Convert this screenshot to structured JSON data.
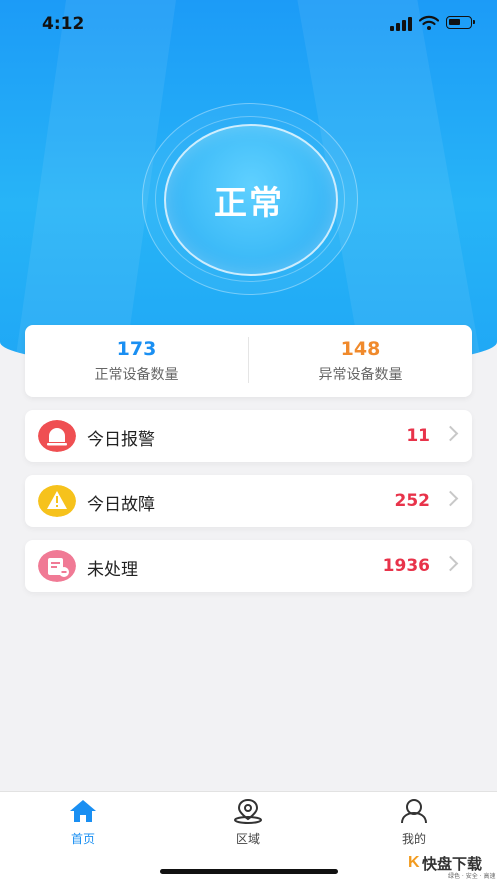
{
  "status_bar": {
    "time": "4:12"
  },
  "hero": {
    "status_label": "正常"
  },
  "stats": {
    "normal": {
      "value": "173",
      "label": "正常设备数量",
      "color": "#1a8ff2"
    },
    "abnormal": {
      "value": "148",
      "label": "异常设备数量",
      "color": "#f08a2c"
    }
  },
  "rows": [
    {
      "label": "今日报警",
      "count": "11",
      "icon": "alarm-light-icon",
      "icon_color": "#ef4f52"
    },
    {
      "label": "今日故障",
      "count": "252",
      "icon": "warning-icon",
      "icon_color": "#f6c21c"
    },
    {
      "label": "未处理",
      "count": "1936",
      "icon": "pending-doc-icon",
      "icon_color": "#f07a95"
    }
  ],
  "tabs": [
    {
      "label": "首页",
      "icon": "home-icon",
      "active": true
    },
    {
      "label": "区域",
      "icon": "location-icon",
      "active": false
    },
    {
      "label": "我的",
      "icon": "user-icon",
      "active": false
    }
  ],
  "watermark": {
    "logo": "K",
    "text": "快盘下载",
    "sub": "绿色 · 安全 · 高速"
  }
}
